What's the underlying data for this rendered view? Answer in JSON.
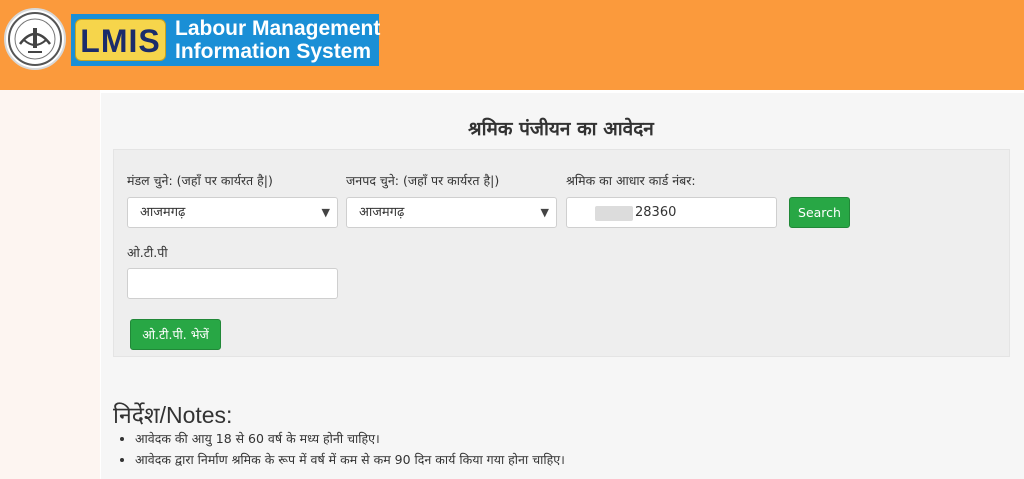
{
  "header": {
    "logo_badge": "LMIS",
    "logo_line1": "Labour Management",
    "logo_line2": "Information System",
    "emblem_icon": "uttar-pradesh-emblem-icon"
  },
  "colors": {
    "header_bg": "#fb9a3c",
    "logo_bg": "#1a8fd6",
    "badge_bg": "#f6d54b",
    "button_green": "#28a745"
  },
  "form": {
    "title": "श्रमिक पंजीयन का आवेदन",
    "division_label": "मंडल चुने: (जहाँ पर कार्यरत है|)",
    "division_value": "आजमगढ़",
    "district_label": "जनपद चुने: (जहाँ पर कार्यरत है|)",
    "district_value": "आजमगढ़",
    "aadhaar_label": "श्रमिक का आधार कार्ड नंबर:",
    "aadhaar_value": "28360",
    "search_label": "Search",
    "otp_label": "ओ.टी.पी",
    "otp_value": "",
    "send_otp_label": "ओ.टी.पी. भेजें"
  },
  "notes": {
    "title": "निर्देश/Notes:",
    "items": [
      "आवेदक की आयु 18 से 60 वर्ष के मध्य होनी चाहिए।",
      "आवेदक द्वारा निर्माण श्रमिक के रूप में वर्ष में कम से कम 90 दिन कार्य किया गया होना चाहिए।"
    ]
  }
}
